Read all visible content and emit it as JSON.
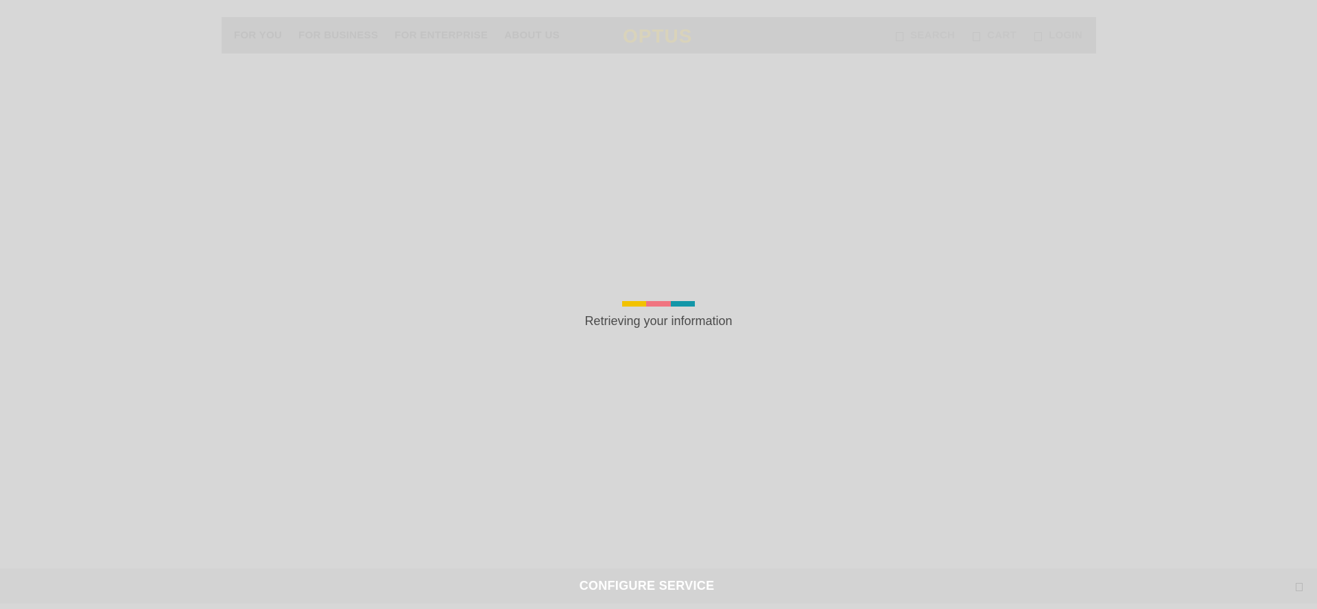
{
  "header": {
    "nav": [
      {
        "label": "FOR YOU"
      },
      {
        "label": "FOR BUSINESS"
      },
      {
        "label": "FOR ENTERPRISE"
      },
      {
        "label": "ABOUT US"
      }
    ],
    "logo": "OPTUS",
    "utility": [
      {
        "label": "SEARCH",
        "icon": "search-icon"
      },
      {
        "label": "CART",
        "icon": "cart-icon"
      },
      {
        "label": "LOGIN",
        "icon": "user-icon"
      }
    ]
  },
  "loader": {
    "colors": [
      "#f2c200",
      "#f07480",
      "#1396a8"
    ],
    "text": "Retrieving your information"
  },
  "bottom_bar": {
    "label": "CONFIGURE SERVICE",
    "icon": "chevron-icon"
  }
}
